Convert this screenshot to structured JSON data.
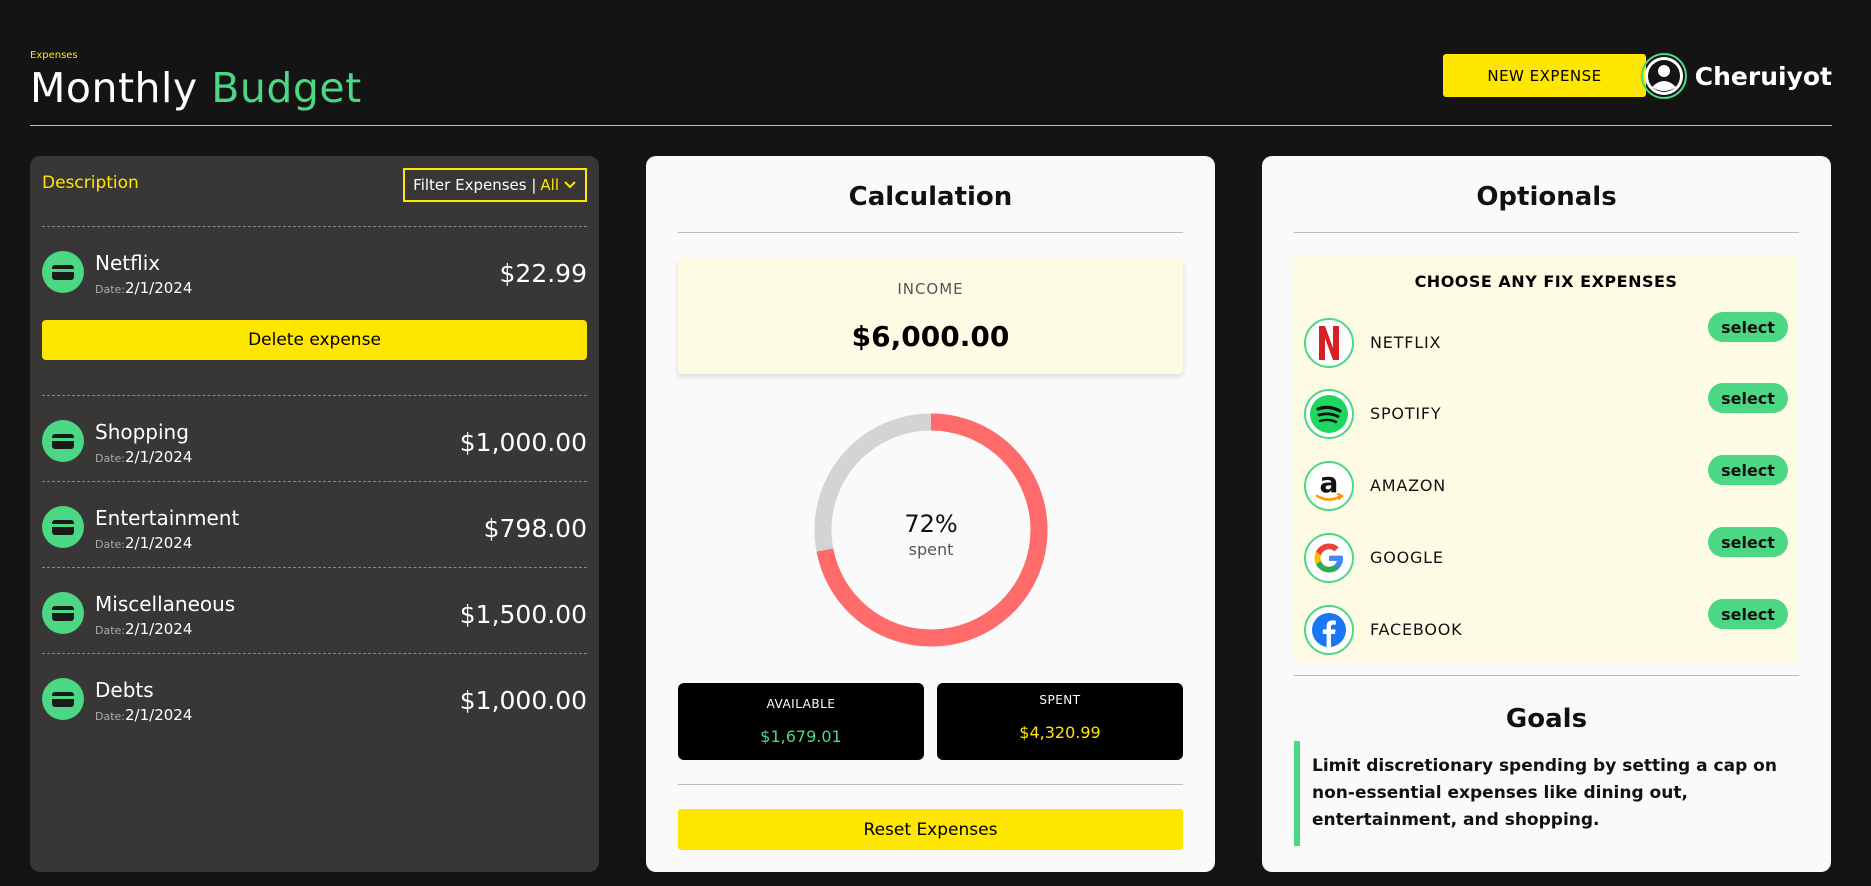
{
  "header": {
    "eyebrow": "Expenses",
    "title_part1": "Monthly",
    "title_part2": "Budget",
    "new_expense_label": "NEW EXPENSE",
    "user_name": "Cheruiyot"
  },
  "expenses_panel": {
    "title": "Description",
    "filter_label": "Filter Expenses |",
    "filter_value": "All",
    "delete_label": "Delete expense",
    "date_label": "Date:",
    "items": [
      {
        "name": "Netflix",
        "date": "2/1/2024",
        "amount": "$22.99"
      },
      {
        "name": "Shopping",
        "date": "2/1/2024",
        "amount": "$1,000.00"
      },
      {
        "name": "Entertainment",
        "date": "2/1/2024",
        "amount": "$798.00"
      },
      {
        "name": "Miscellaneous",
        "date": "2/1/2024",
        "amount": "$1,500.00"
      },
      {
        "name": "Debts",
        "date": "2/1/2024",
        "amount": "$1,000.00"
      }
    ]
  },
  "calculation": {
    "title": "Calculation",
    "income_label": "INCOME",
    "income_value": "$6,000.00",
    "spent_percent": 72,
    "spent_percent_label": "72%",
    "spent_caption": "spent",
    "available_label": "AVAILABLE",
    "available_value": "$1,679.01",
    "spent_label": "SPENT",
    "spent_value": "$4,320.99",
    "reset_label": "Reset Expenses",
    "colors": {
      "spent": "#ff6b6b",
      "remaining": "#d4d4d4",
      "available_text": "#4cd784",
      "spent_text": "#ffe600"
    }
  },
  "optionals": {
    "title": "Optionals",
    "fix_title": "CHOOSE ANY FIX EXPENSES",
    "select_label": "select",
    "items": [
      {
        "name": "NETFLIX",
        "icon": "netflix-logo"
      },
      {
        "name": "SPOTIFY",
        "icon": "spotify-logo"
      },
      {
        "name": "AMAZON",
        "icon": "amazon-logo"
      },
      {
        "name": "GOOGLE",
        "icon": "google-logo"
      },
      {
        "name": "FACEBOOK",
        "icon": "facebook-logo"
      }
    ],
    "goals_title": "Goals",
    "goal_text": "Limit discretionary spending by setting a cap on non-essential expenses like dining out, entertainment, and shopping."
  },
  "theme": {
    "accent_yellow": "#ffe600",
    "accent_green": "#4cd784",
    "background": "#141414",
    "panel_dark": "#383736"
  }
}
